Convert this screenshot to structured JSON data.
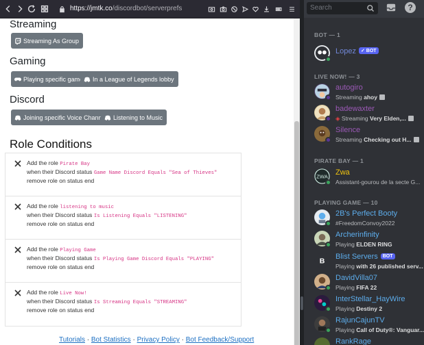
{
  "browser": {
    "url_protocol_hidden": true,
    "url_domain": "https://jmtk.co",
    "url_path": "/discordbot/serverprefs"
  },
  "page": {
    "sections": [
      {
        "title": "Streaming",
        "buttons": [
          {
            "label": "Streaming As Group",
            "icon": "twitch-icon"
          }
        ]
      },
      {
        "title": "Gaming",
        "buttons": [
          {
            "label": "Playing specific game",
            "icon": "gamepad-icon"
          },
          {
            "label": "In a League of Legends lobby",
            "icon": "discord-icon"
          }
        ]
      },
      {
        "title": "Discord",
        "buttons": [
          {
            "label": "Joining specific Voice Channel",
            "icon": "discord-icon"
          },
          {
            "label": "Listening to Music",
            "icon": "discord-icon"
          }
        ]
      }
    ],
    "role_conditions_title": "Role Conditions",
    "conditions": [
      {
        "add_prefix": "Add the role",
        "role": "Pirate Bay",
        "when_prefix": "when their Discord status",
        "condition": "Game Name Discord Equals \"Sea of Thieves\"",
        "remove_text": "remove role on status end"
      },
      {
        "add_prefix": "Add the role",
        "role": "listening to music",
        "when_prefix": "when their Discord status",
        "condition": "Is Listening Equals \"LISTENING\"",
        "remove_text": "remove role on status end"
      },
      {
        "add_prefix": "Add the role",
        "role": "Playing Game",
        "when_prefix": "when their Discord status",
        "condition": "Is Playing Game Discord Equals \"PLAYING\"",
        "remove_text": "remove role on status end"
      },
      {
        "add_prefix": "Add the role",
        "role": "Live Now!",
        "when_prefix": "when their Discord status",
        "condition": "Is Streaming Equals \"STREAMING\"",
        "remove_text": "remove role on status end"
      }
    ],
    "footer": {
      "links": [
        "Tutorials",
        "Bot Statistics",
        "Privacy Policy",
        "Bot Feedback/Support"
      ],
      "separator": " · "
    }
  },
  "discord": {
    "search_placeholder": "Search",
    "help_label": "?",
    "categories": [
      {
        "label": "BOT — 1"
      },
      {
        "label": "LIVE NOW! — 3"
      },
      {
        "label": "PIRATE BAY — 1"
      },
      {
        "label": "PLAYING GAME — 10"
      }
    ],
    "members": [
      {
        "name": "Lopez",
        "bot": "BOT",
        "activity_prefix": "",
        "activity_bold": "",
        "color": "#7289da",
        "status": "#3ba55d"
      },
      {
        "name": "autogiro",
        "activity_prefix": "Streaming ",
        "activity_bold": "ahoy",
        "color": "#9b59b6",
        "status": "#593695"
      },
      {
        "name": "badewaxter",
        "activity_prefix": "Streaming ",
        "activity_bold": "Very Elden,...",
        "color": "#9b59b6",
        "status": "#593695"
      },
      {
        "name": "Silence",
        "activity_prefix": "Streaming ",
        "activity_bold": "Checking out H...",
        "color": "#9b59b6",
        "status": "#593695"
      },
      {
        "name": "Zwa",
        "activity_prefix": "Assistant-gourou de la secte G...",
        "activity_bold": "",
        "color": "#f1c40f",
        "status": "#3ba55d"
      },
      {
        "name": "2B's Perfect Booty",
        "activity_prefix": "#FreedomConvoy2022",
        "activity_bold": "",
        "color": "#5dadec",
        "status": "#3ba55d"
      },
      {
        "name": "Archerinfinity",
        "activity_prefix": "Playing ",
        "activity_bold": "ELDEN RING",
        "color": "#5dadec",
        "status": "#3ba55d"
      },
      {
        "name": "Blist Servers",
        "bot": "BOT",
        "activity_prefix": "Playing ",
        "activity_bold": "with 26 published serv...",
        "color": "#5dadec",
        "status": "#3ba55d"
      },
      {
        "name": "DavidVilla07",
        "activity_prefix": "Playing ",
        "activity_bold": "FIFA 22",
        "color": "#5dadec",
        "status": "#3ba55d"
      },
      {
        "name": "InterStellar_HayWire",
        "activity_prefix": "Playing ",
        "activity_bold": "Destiny 2",
        "color": "#5dadec",
        "status": "#3ba55d"
      },
      {
        "name": "RajunCajunTV",
        "activity_prefix": "Playing ",
        "activity_bold": "Call of Duty®: Vanguar...",
        "color": "#5dadec",
        "status": "#3ba55d"
      },
      {
        "name": "RankRage",
        "activity_prefix": "",
        "activity_bold": "",
        "color": "#5dadec",
        "status": "#3ba55d"
      }
    ]
  }
}
